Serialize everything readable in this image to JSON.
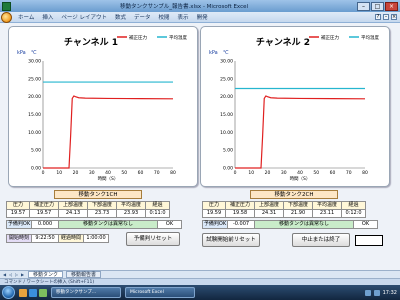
{
  "window": {
    "title": "移動タンクサンプル_報告書.xlsx - Microsoft Excel"
  },
  "ribbon": {
    "tabs": [
      "ホーム",
      "挿入",
      "ページ レイアウト",
      "数式",
      "データ",
      "校閲",
      "表示",
      "開発"
    ]
  },
  "colors": {
    "accent_red": "#e02020",
    "accent_cyan": "#26b6cf"
  },
  "icons": [
    "office-button-icon",
    "minimize-icon",
    "maximize-icon",
    "close-icon",
    "start-orb-icon"
  ],
  "chart_data": [
    {
      "type": "line",
      "title": "チャンネル 1",
      "y_unit_left": "kPa",
      "y_unit_right": "℃",
      "xlabel": "時間（S）",
      "xlim": [
        0,
        80
      ],
      "ylim": [
        0,
        30
      ],
      "xticks": [
        0,
        10,
        20,
        30,
        40,
        50,
        60,
        70,
        80
      ],
      "yticks": [
        "0.00",
        "5.00",
        "10.00",
        "15.00",
        "20.00",
        "25.00",
        "30.00"
      ],
      "legend_position": "top-right",
      "series": [
        {
          "name": "補正圧力",
          "color": "#e02020",
          "x": [
            0,
            16,
            17,
            18,
            19,
            20,
            22,
            26,
            40,
            60,
            80
          ],
          "y": [
            0,
            0,
            9,
            19.5,
            20.2,
            20.0,
            19.7,
            19.6,
            19.5,
            19.45,
            19.4
          ]
        },
        {
          "name": "平均温度",
          "color": "#26b6cf",
          "x": [
            0,
            80
          ],
          "y": [
            24.1,
            24.1
          ]
        }
      ]
    },
    {
      "type": "line",
      "title": "チャンネル 2",
      "y_unit_left": "kPa",
      "y_unit_right": "℃",
      "xlabel": "時間（S）",
      "xlim": [
        0,
        80
      ],
      "ylim": [
        0,
        30
      ],
      "xticks": [
        0,
        10,
        20,
        30,
        40,
        50,
        60,
        70,
        80
      ],
      "yticks": [
        "0.00",
        "5.00",
        "10.00",
        "15.00",
        "20.00",
        "25.00",
        "30.00"
      ],
      "legend_position": "top-right",
      "series": [
        {
          "name": "補正圧力",
          "color": "#e02020",
          "x": [
            0,
            16,
            17,
            18,
            19,
            20,
            22,
            26,
            40,
            60,
            80
          ],
          "y": [
            0,
            0,
            9,
            19.5,
            20.2,
            20.0,
            19.7,
            19.6,
            19.5,
            19.45,
            19.4
          ]
        },
        {
          "name": "平均温度",
          "color": "#26b6cf",
          "x": [
            0,
            80
          ],
          "y": [
            22.3,
            22.3
          ]
        }
      ]
    }
  ],
  "panel1": {
    "header": "移動タンク1CH",
    "columns": [
      "圧力",
      "補正圧力",
      "上部温度",
      "下部温度",
      "平均温度",
      "経過"
    ],
    "values": [
      "19.57",
      "19.57",
      "24.13",
      "23.73",
      "23.93",
      "0:11:0"
    ],
    "status_label": "予備判OK",
    "status_value": "0.000",
    "status_message": "移動タンクは異常なし",
    "status_ok": "OK",
    "start_label": "開始時刻",
    "start_value": "9:22:50",
    "elapsed_label": "経過時間",
    "elapsed_value": "1:00:00",
    "reset_button": "予備判リセット"
  },
  "panel2": {
    "header": "移動タンク2CH",
    "columns": [
      "圧力",
      "補正圧力",
      "上部温度",
      "下部温度",
      "平均温度",
      "経過"
    ],
    "values": [
      "19.59",
      "19.58",
      "24.31",
      "21.90",
      "23.11",
      "0:12:0"
    ],
    "status_label": "予備判OK",
    "status_value": "-0.007",
    "status_message": "移動タンクは異常なし",
    "status_ok": "OK",
    "reset_button": "試験開始前リセット",
    "stop_button": "中止または終了"
  },
  "sheet_tabs": [
    "移動タンク",
    "移動報告書"
  ],
  "status_bar": "コマンド / ワークシートの挿入 (Shift+F11)",
  "taskbar": {
    "task1": "移動タンクサンプ...",
    "task2": "Microsoft Excel",
    "clock": "17:32"
  }
}
